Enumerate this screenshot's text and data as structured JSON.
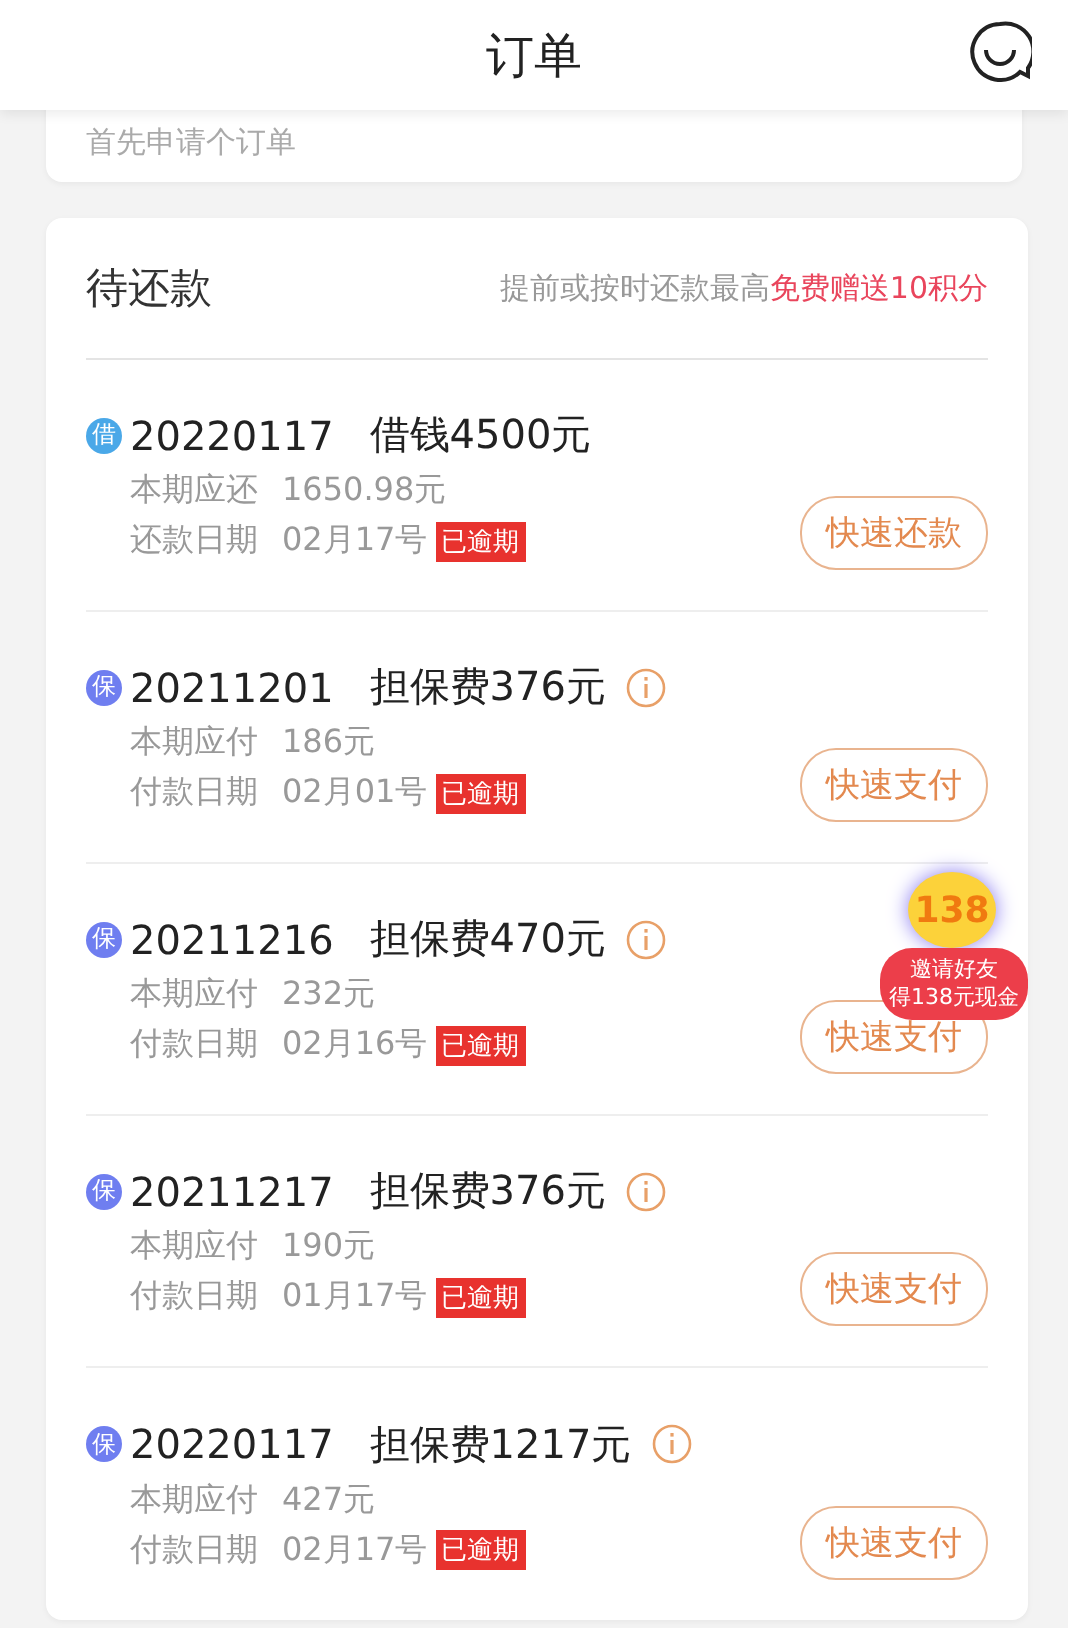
{
  "header": {
    "title": "订单"
  },
  "top_card": {
    "text": "首先申请个订单"
  },
  "pending": {
    "title": "待还款",
    "promo": "提前或按时还款最高**免费赠送10积分**",
    "rows": [
      {
        "tag": "借",
        "color": "#4aa8e8",
        "date": "20220117",
        "title": "借钱4500元",
        "info": false,
        "amount_label": "本期应还",
        "amount": "1650.98元",
        "due_label": "还款日期",
        "due": "02月17号",
        "overdue": "已逾期",
        "button": "快速还款"
      },
      {
        "tag": "保",
        "color": "#6f7ef0",
        "date": "20211201",
        "title": "担保费376元",
        "info": true,
        "amount_label": "本期应付",
        "amount": "186元",
        "due_label": "付款日期",
        "due": "02月01号",
        "overdue": "已逾期",
        "button": "快速支付"
      },
      {
        "tag": "保",
        "color": "#6f7ef0",
        "date": "20211216",
        "title": "担保费470元",
        "info": true,
        "amount_label": "本期应付",
        "amount": "232元",
        "due_label": "付款日期",
        "due": "02月16号",
        "overdue": "已逾期",
        "button": "快速支付"
      },
      {
        "tag": "保",
        "color": "#6f7ef0",
        "date": "20211217",
        "title": "担保费376元",
        "info": true,
        "amount_label": "本期应付",
        "amount": "190元",
        "due_label": "付款日期",
        "due": "01月17号",
        "overdue": "已逾期",
        "button": "快速支付"
      },
      {
        "tag": "保",
        "color": "#6f7ef0",
        "date": "20220117",
        "title": "担保费1217元",
        "info": true,
        "amount_label": "本期应付",
        "amount": "427元",
        "due_label": "付款日期",
        "due": "02月17号",
        "overdue": "已逾期",
        "button": "快速支付"
      }
    ]
  },
  "invite_badge": {
    "number": "138",
    "line1": "邀请好友",
    "line2": "得138元现金"
  }
}
